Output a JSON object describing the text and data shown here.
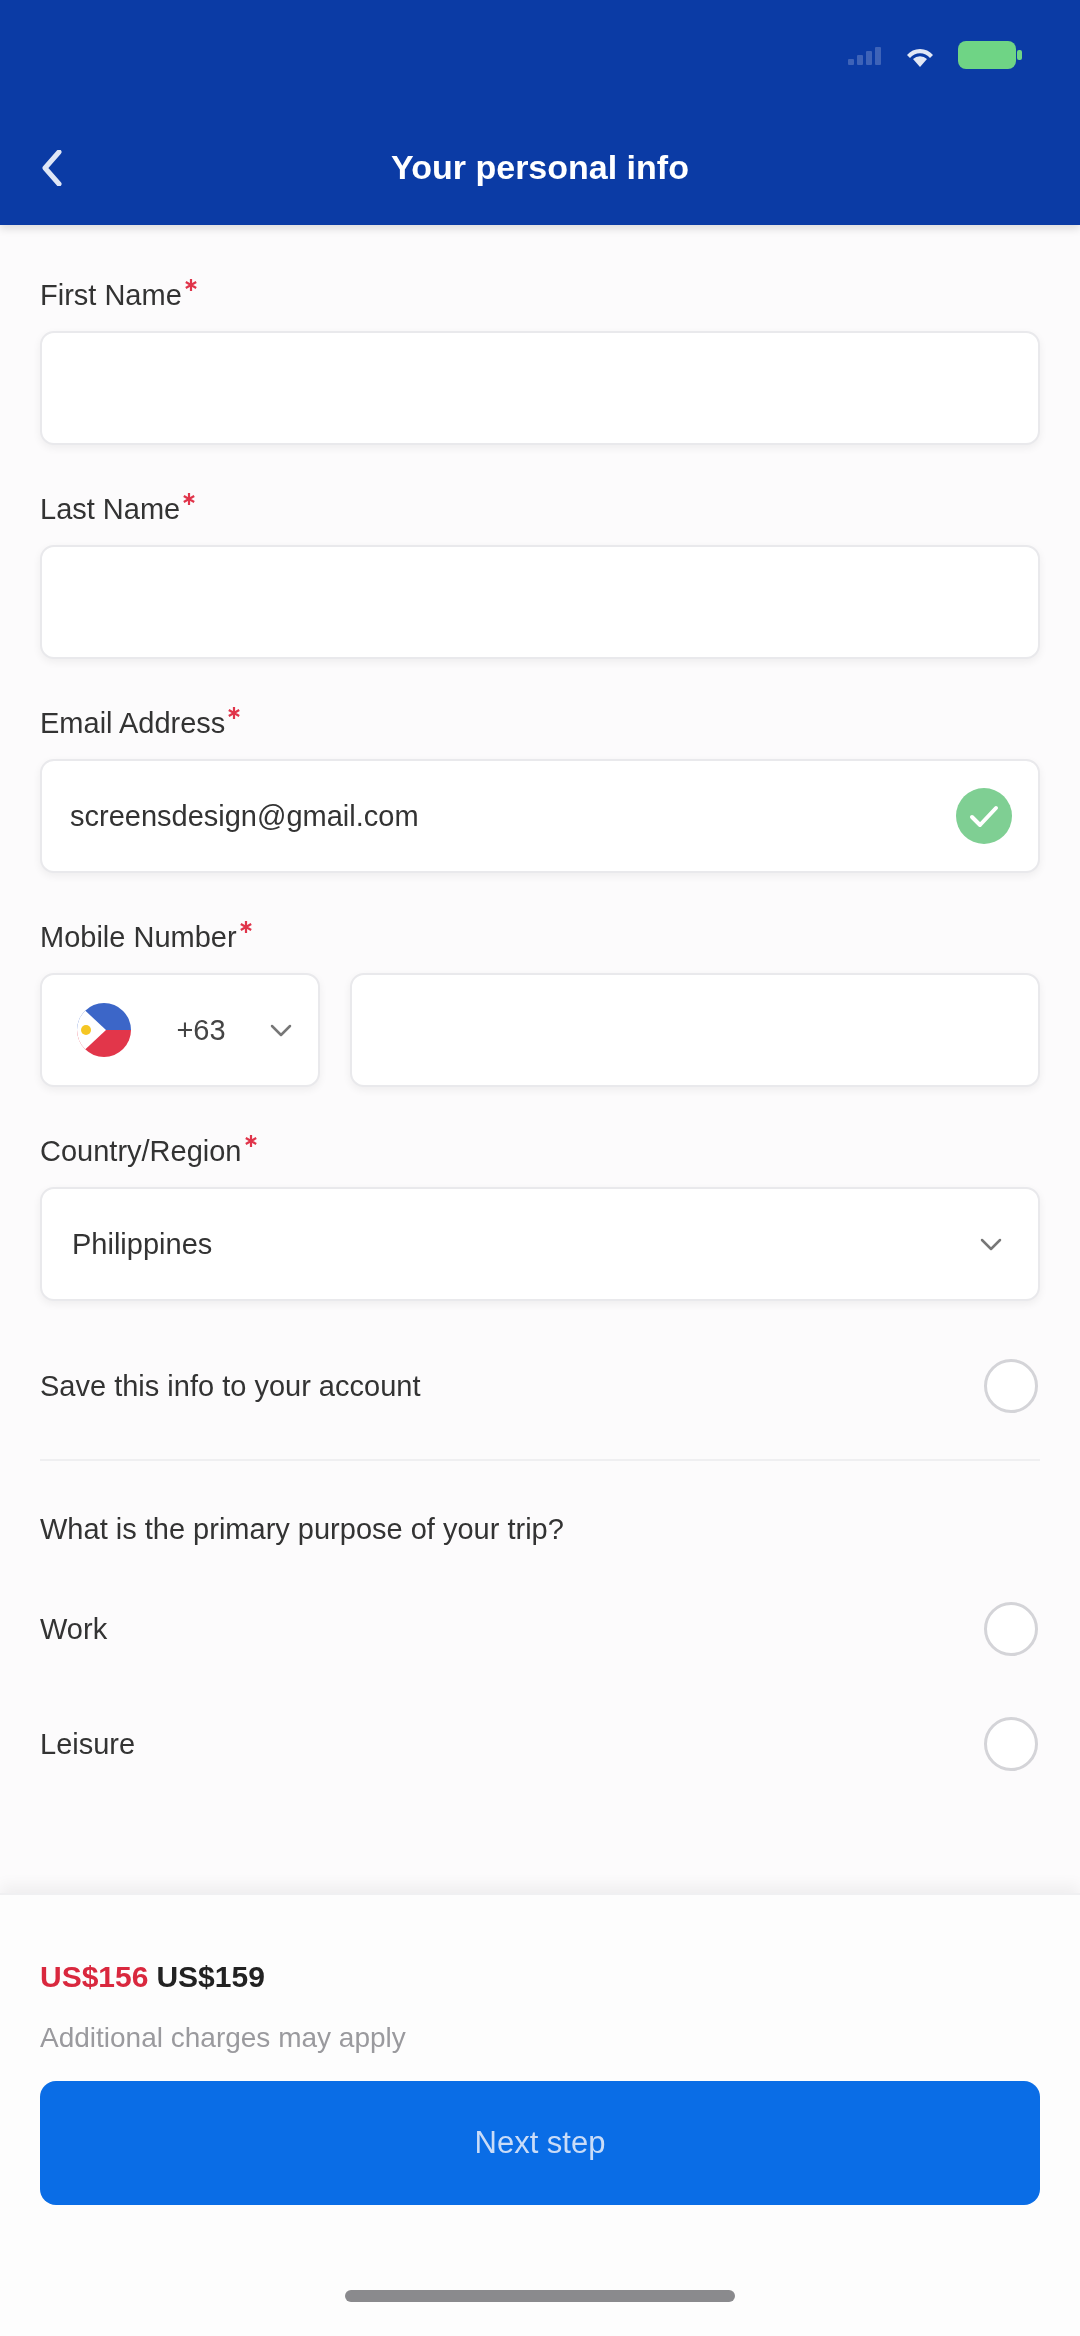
{
  "nav": {
    "title": "Your personal info"
  },
  "fields": [
    {
      "kind": "text",
      "label": "First Name",
      "required": true
    },
    {
      "kind": "text",
      "label": "Last Name",
      "required": true
    },
    {
      "kind": "email",
      "label": "Email Address",
      "required": true,
      "value": "screensdesign@gmail.com",
      "valid": true
    },
    {
      "kind": "phone",
      "label": "Mobile Number",
      "required": true,
      "country_code": "+63"
    },
    {
      "kind": "select",
      "label": "Country/Region",
      "required": true,
      "value": "Philippines"
    }
  ],
  "save_info": {
    "label": "Save this info to your account",
    "checked": false
  },
  "trip_purpose": {
    "question": "What is the primary purpose of your trip?",
    "options": [
      {
        "label": "Work",
        "selected": false
      },
      {
        "label": "Leisure",
        "selected": false
      }
    ]
  },
  "footer": {
    "prices": [
      {
        "text": "US$156",
        "color": "#d9283e"
      },
      {
        "text": "US$159",
        "color": "#222222"
      }
    ],
    "note": "Additional charges may apply",
    "button": "Next step"
  }
}
